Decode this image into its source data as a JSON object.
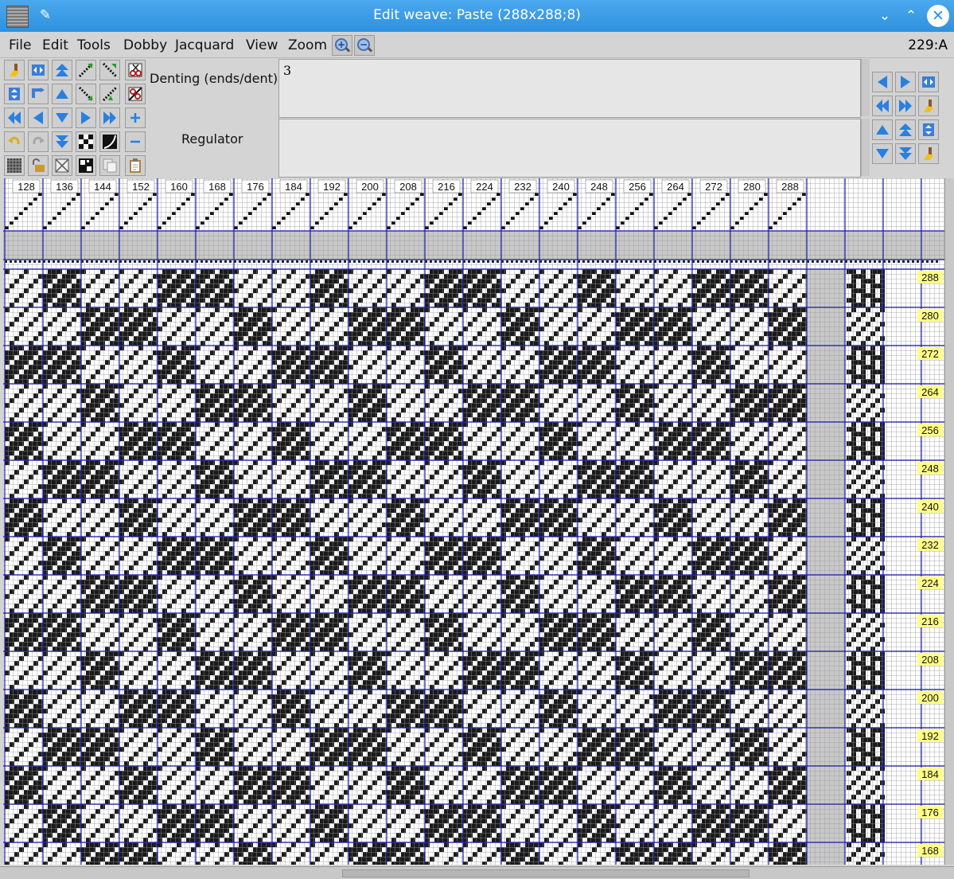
{
  "window": {
    "title": "Edit weave: Paste (288x288;8)"
  },
  "menu": {
    "items": [
      "File",
      "Edit",
      "Tools",
      "Dobby",
      "Jacquard",
      "View",
      "Zoom"
    ]
  },
  "status": "229:A",
  "fields": {
    "denting_label": "Denting (ends/dent)",
    "denting_value": "3",
    "regulator_label": "Regulator",
    "regulator_value": ""
  },
  "ruler": {
    "column_labels": [
      "128",
      "136",
      "144",
      "152",
      "160",
      "168",
      "176",
      "184",
      "192",
      "200",
      "208",
      "216",
      "224",
      "232",
      "240",
      "248",
      "256",
      "264",
      "272",
      "280",
      "288"
    ],
    "row_labels": [
      "288",
      "280",
      "272",
      "264",
      "256",
      "248",
      "240",
      "232",
      "224",
      "216",
      "208",
      "200",
      "192",
      "184",
      "176",
      "168"
    ]
  },
  "colors": {
    "grid_major": "#1c1ca8",
    "grid_minor": "#9a9a9a",
    "label_bg": "#ffff88",
    "title_bar": "#3d9be9"
  }
}
